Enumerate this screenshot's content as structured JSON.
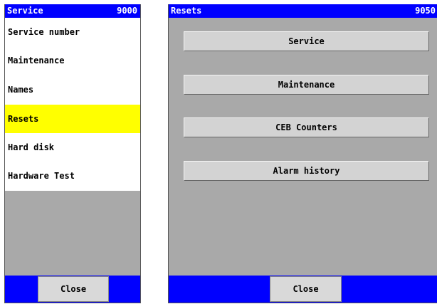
{
  "left_window": {
    "title": "Service",
    "code": "9000",
    "menu": [
      {
        "label": "Service number",
        "selected": false
      },
      {
        "label": "Maintenance",
        "selected": false
      },
      {
        "label": "Names",
        "selected": false
      },
      {
        "label": "Resets",
        "selected": true
      },
      {
        "label": "Hard disk",
        "selected": false
      },
      {
        "label": "Hardware Test",
        "selected": false
      }
    ],
    "close_label": "Close"
  },
  "right_window": {
    "title": "Resets",
    "code": "9050",
    "buttons": [
      "Service",
      "Maintenance",
      "CEB Counters",
      "Alarm history"
    ],
    "close_label": "Close"
  },
  "colors": {
    "titlebar": "#0000ff",
    "selected": "#ffff00",
    "panel_grey": "#a9a9a9",
    "button": "#d3d3d3"
  }
}
